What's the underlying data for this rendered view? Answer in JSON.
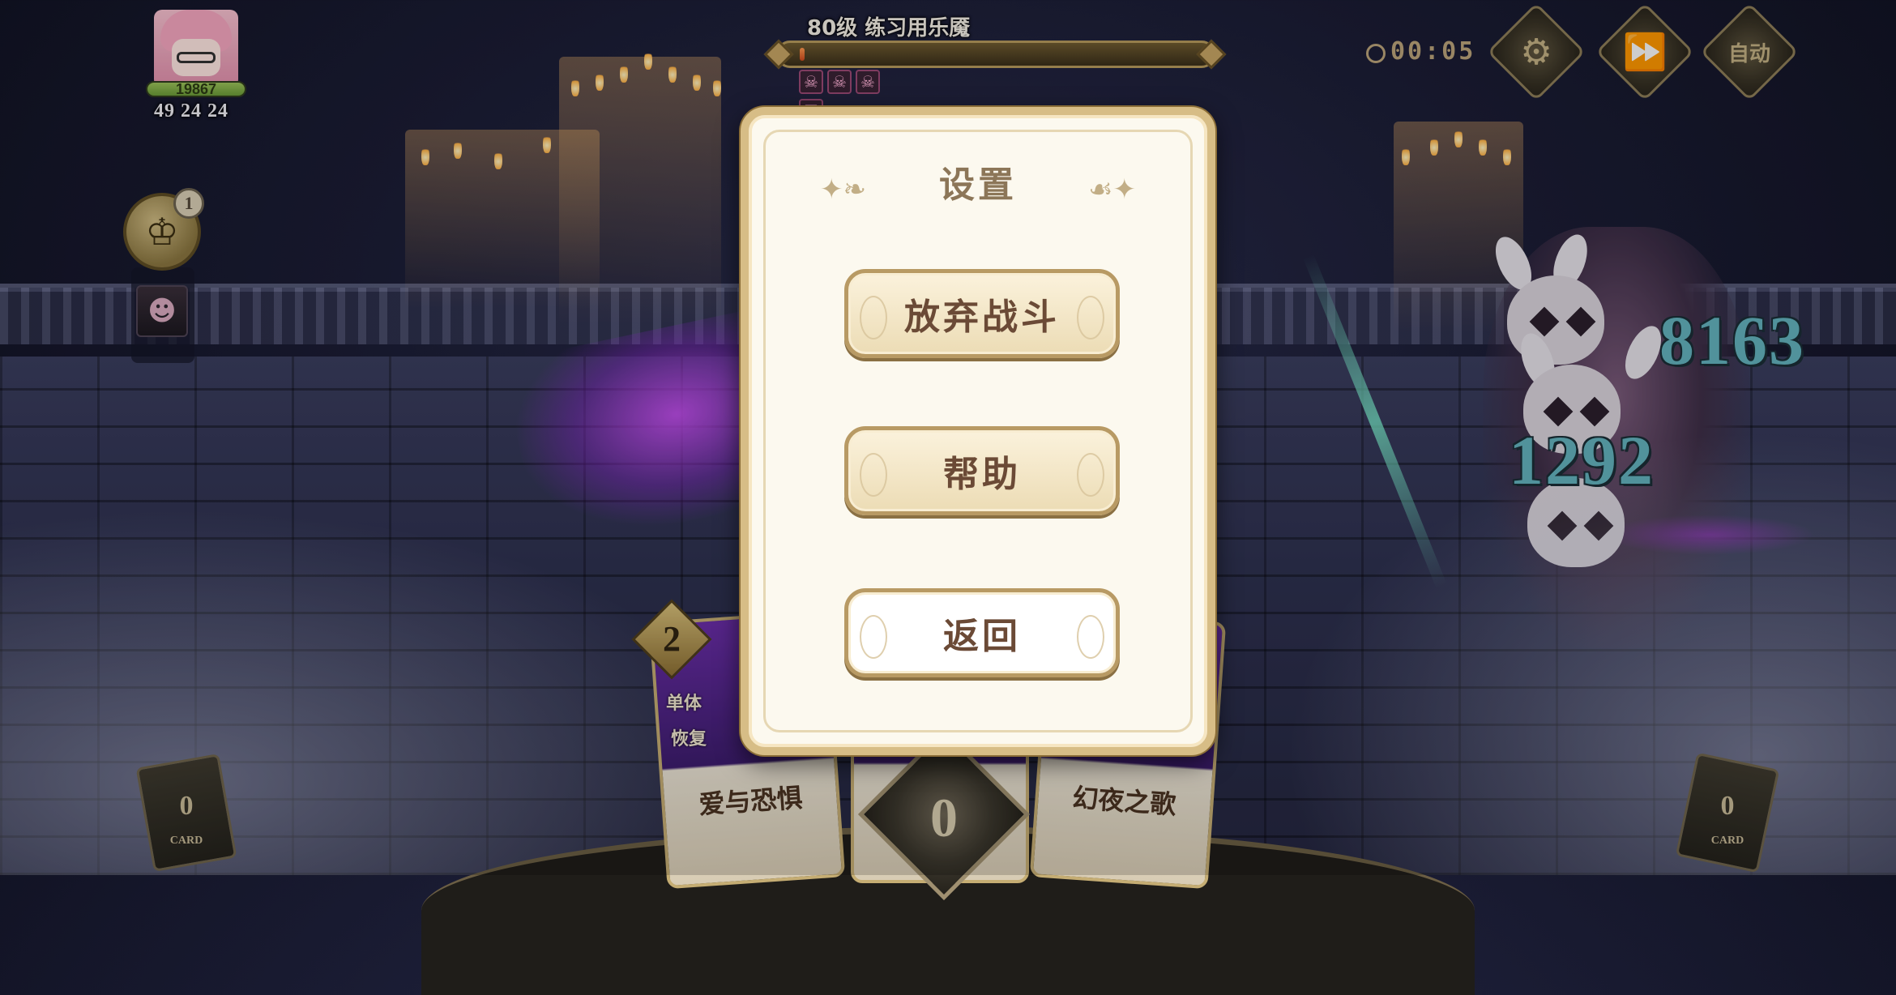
{
  "player": {
    "hp_value": "19867",
    "stats_text": "49 24 24",
    "trophy_count": "1"
  },
  "boss": {
    "name": "80级 练习用乐魇",
    "hp_fraction": 0.01,
    "debuff_icons": [
      "skull-icon",
      "skull-icon",
      "skull-icon",
      "shield-icon"
    ]
  },
  "controls": {
    "timer": "00:05",
    "settings_icon": "gear-icon",
    "speed_icon": "fast-forward-icon",
    "auto_label": "自动"
  },
  "damage_numbers": [
    "8163",
    "1292"
  ],
  "cards": [
    {
      "name": "爱与恐惧",
      "cost": "2",
      "tags": [
        "单体",
        "恢复"
      ]
    },
    {
      "name": "",
      "cost": "",
      "tags": []
    },
    {
      "name": "幻夜之歌",
      "cost": "",
      "tags": []
    }
  ],
  "energy": "0",
  "deck": {
    "draw_count": "0",
    "discard_count": "0",
    "label": "CARD"
  },
  "modal": {
    "title": "设置",
    "buttons": {
      "abandon": "放弃战斗",
      "help": "帮助",
      "back": "返回"
    }
  },
  "colors": {
    "modal_bg": "#fcf9ef",
    "modal_border": "#d7bd86",
    "button_text": "#6b4a36",
    "damage": "#63b3bd"
  }
}
